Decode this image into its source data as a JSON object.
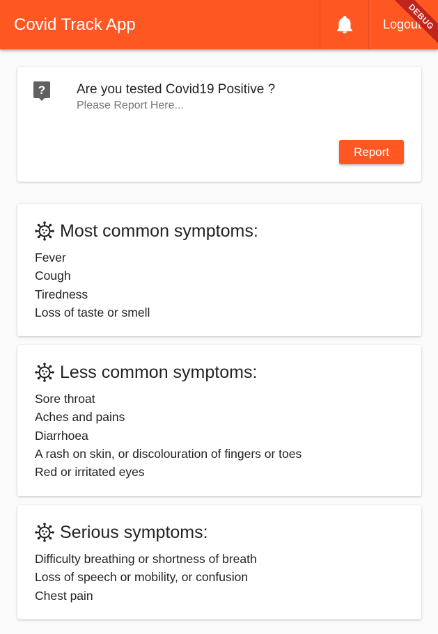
{
  "appbar": {
    "title": "Covid Track App",
    "logout_label": "Logout",
    "debug_label": "DEBUG",
    "color": "#ff5722"
  },
  "report_card": {
    "icon": "help-icon",
    "title": "Are you tested Covid19 Positive ?",
    "subtitle": "Please Report Here...",
    "button_label": "Report"
  },
  "symptom_cards": [
    {
      "icon": "virus-icon",
      "title": "Most common symptoms:",
      "items": [
        "Fever",
        "Cough",
        "Tiredness",
        "Loss of taste or smell"
      ]
    },
    {
      "icon": "virus-icon",
      "title": "Less common symptoms:",
      "items": [
        "Sore throat",
        "Aches and pains",
        "Diarrhoea",
        "A rash on skin, or discolouration of fingers or toes",
        "Red or irritated eyes"
      ]
    },
    {
      "icon": "virus-icon",
      "title": "Serious symptoms:",
      "items": [
        "Difficulty breathing or shortness of breath",
        "Loss of speech or mobility, or confusion",
        "Chest pain"
      ]
    }
  ]
}
